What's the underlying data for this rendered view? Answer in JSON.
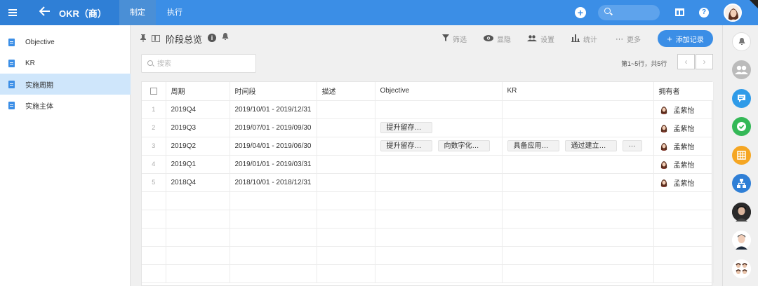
{
  "topbar": {
    "app_title": "OKR（商）",
    "tabs": [
      {
        "label": "制定",
        "active": true
      },
      {
        "label": "执行",
        "active": false
      }
    ],
    "icons": [
      "menu-icon",
      "back-arrow-icon",
      "add-icon",
      "search-icon",
      "book-icon",
      "help-icon",
      "user-avatar"
    ]
  },
  "sidebar": {
    "items": [
      {
        "label": "Objective",
        "active": false
      },
      {
        "label": "KR",
        "active": false
      },
      {
        "label": "实施周期",
        "active": true
      },
      {
        "label": "实施主体",
        "active": false
      }
    ]
  },
  "header": {
    "title": "阶段总览",
    "tools": [
      "筛选",
      "显隐",
      "设置",
      "统计",
      "更多"
    ],
    "add_record": "添加记录"
  },
  "search": {
    "placeholder": "搜索"
  },
  "pagination": {
    "info": "第1~5行，共5行",
    "prev": "‹",
    "next": "›"
  },
  "table": {
    "columns": [
      "周期",
      "时间段",
      "描述",
      "Objective",
      "KR",
      "拥有者"
    ],
    "rows": [
      {
        "num": "1",
        "period": "2019Q4",
        "range": "2019/10/01 - 2019/12/31",
        "desc": "",
        "objective": [],
        "kr": [],
        "owner": "孟紫怡"
      },
      {
        "num": "2",
        "period": "2019Q3",
        "range": "2019/07/01 - 2019/09/30",
        "desc": "",
        "objective": [
          "提升留存…"
        ],
        "kr": [],
        "owner": "孟紫怡"
      },
      {
        "num": "3",
        "period": "2019Q2",
        "range": "2019/04/01 - 2019/06/30",
        "desc": "",
        "objective": [
          "提升留存…",
          "向数字化…"
        ],
        "kr": [
          "具备应用…",
          "通过建立…"
        ],
        "kr_more": "···",
        "owner": "孟紫怡"
      },
      {
        "num": "4",
        "period": "2019Q1",
        "range": "2019/01/01 - 2019/03/31",
        "desc": "",
        "objective": [],
        "kr": [],
        "owner": "孟紫怡"
      },
      {
        "num": "5",
        "period": "2018Q4",
        "range": "2018/10/01 - 2018/12/31",
        "desc": "",
        "objective": [],
        "kr": [],
        "owner": "孟紫怡"
      }
    ]
  },
  "right_rail": {
    "icons": [
      "bell-icon",
      "group-icon",
      "chat-icon",
      "check-icon",
      "table-icon",
      "org-chart-icon",
      "member-avatar",
      "member-avatar",
      "member-avatar"
    ]
  },
  "colors": {
    "primary": "#3b8ee6",
    "sidebar_active": "#cfe6fb",
    "check_green": "#34b857",
    "table_orange": "#f5a623"
  }
}
